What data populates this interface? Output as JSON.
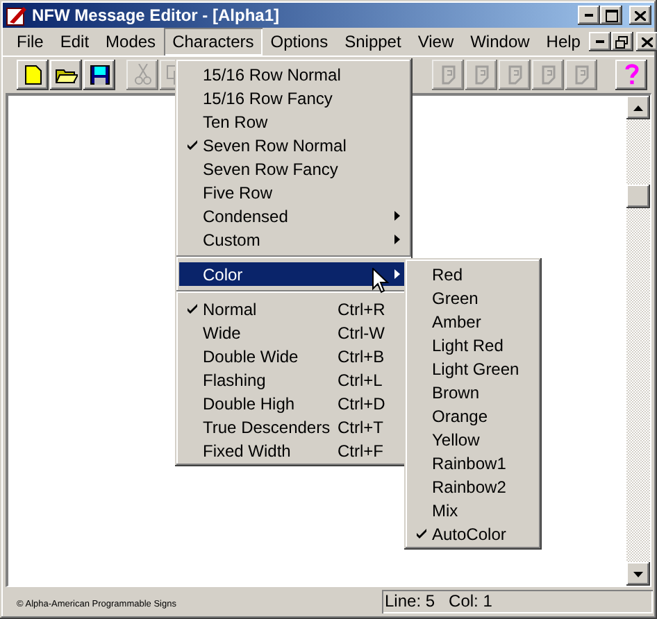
{
  "window": {
    "title": "NFW Message Editor - [Alpha1]"
  },
  "menu_bar": [
    {
      "label": "File",
      "selected": false
    },
    {
      "label": "Edit",
      "selected": false
    },
    {
      "label": "Modes",
      "selected": false
    },
    {
      "label": "Characters",
      "selected": true
    },
    {
      "label": "Options",
      "selected": false
    },
    {
      "label": "Snippet",
      "selected": false
    },
    {
      "label": "View",
      "selected": false
    },
    {
      "label": "Window",
      "selected": false
    },
    {
      "label": "Help",
      "selected": false
    }
  ],
  "characters_menu": [
    {
      "kind": "item",
      "label": "15/16 Row Normal",
      "checked": false,
      "selected": false
    },
    {
      "kind": "item",
      "label": "15/16 Row Fancy",
      "checked": false,
      "selected": false
    },
    {
      "kind": "item",
      "label": "Ten Row",
      "checked": false,
      "selected": false
    },
    {
      "kind": "item",
      "label": "Seven Row Normal",
      "checked": true,
      "selected": false
    },
    {
      "kind": "item",
      "label": "Seven Row Fancy",
      "checked": false,
      "selected": false
    },
    {
      "kind": "item",
      "label": "Five Row",
      "checked": false,
      "selected": false
    },
    {
      "kind": "submenu",
      "label": "Condensed",
      "checked": false,
      "selected": false
    },
    {
      "kind": "submenu",
      "label": "Custom",
      "checked": false,
      "selected": false
    },
    {
      "kind": "separator"
    },
    {
      "kind": "submenu",
      "label": "Color",
      "checked": false,
      "selected": true
    },
    {
      "kind": "separator"
    },
    {
      "kind": "item",
      "label": "Normal",
      "shortcut": "Ctrl+R",
      "checked": true,
      "selected": false
    },
    {
      "kind": "item",
      "label": "Wide",
      "shortcut": "Ctrl-W",
      "checked": false,
      "selected": false
    },
    {
      "kind": "item",
      "label": "Double Wide",
      "shortcut": "Ctrl+B",
      "checked": false,
      "selected": false
    },
    {
      "kind": "item",
      "label": "Flashing",
      "shortcut": "Ctrl+L",
      "checked": false,
      "selected": false
    },
    {
      "kind": "item",
      "label": "Double High",
      "shortcut": "Ctrl+D",
      "checked": false,
      "selected": false
    },
    {
      "kind": "item",
      "label": "True Descenders",
      "shortcut": "Ctrl+T",
      "checked": false,
      "selected": false
    },
    {
      "kind": "item",
      "label": "Fixed Width",
      "shortcut": "Ctrl+F",
      "checked": false,
      "selected": false
    }
  ],
  "color_menu": [
    {
      "label": "Red",
      "checked": false
    },
    {
      "label": "Green",
      "checked": false
    },
    {
      "label": "Amber",
      "checked": false
    },
    {
      "label": "Light Red",
      "checked": false
    },
    {
      "label": "Light Green",
      "checked": false
    },
    {
      "label": "Brown",
      "checked": false
    },
    {
      "label": "Orange",
      "checked": false
    },
    {
      "label": "Yellow",
      "checked": false
    },
    {
      "label": "Rainbow1",
      "checked": false
    },
    {
      "label": "Rainbow2",
      "checked": false
    },
    {
      "label": "Mix",
      "checked": false
    },
    {
      "label": "AutoColor",
      "checked": true
    }
  ],
  "status_bar": {
    "copyright": "© Alpha-American Programmable Signs",
    "position": "Line: 5   Col: 1"
  }
}
